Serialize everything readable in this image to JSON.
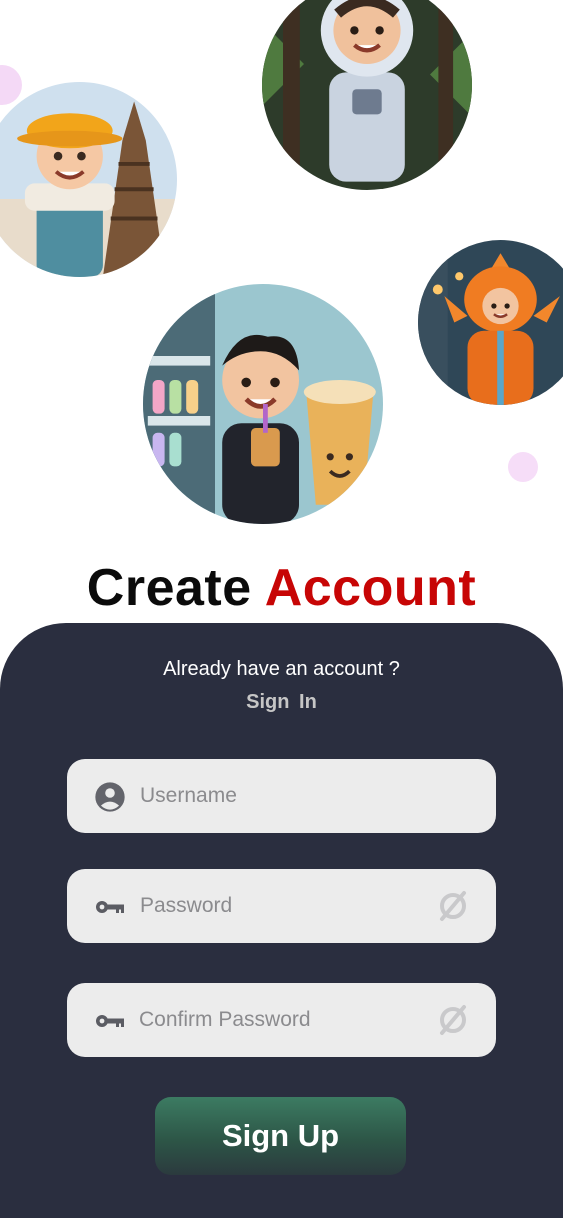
{
  "header": {
    "title_main": "Create",
    "title_accent": "Account",
    "accent_color": "#c70505"
  },
  "avatars": [
    {
      "name": "construction-worker-eiffel-tower"
    },
    {
      "name": "astronaut-in-forest"
    },
    {
      "name": "boy-with-boba-tea"
    },
    {
      "name": "boy-in-fish-costume"
    }
  ],
  "auth": {
    "prompt": "Already have an account ?",
    "signin_label": "Sign  In"
  },
  "form": {
    "username": {
      "placeholder": "Username",
      "value": "",
      "icon": "user-circle-icon"
    },
    "password": {
      "placeholder": "Password",
      "value": "",
      "icon": "key-icon",
      "toggle_icon": "eye-off-icon"
    },
    "confirm_password": {
      "placeholder": "Confirm Password",
      "value": "",
      "icon": "key-icon",
      "toggle_icon": "eye-off-icon"
    },
    "submit_label": "Sign Up"
  },
  "colors": {
    "panel": "#2a2e3f",
    "field": "#ececec",
    "button_top": "#3c7b62",
    "button_bottom": "#2b3a3e"
  }
}
